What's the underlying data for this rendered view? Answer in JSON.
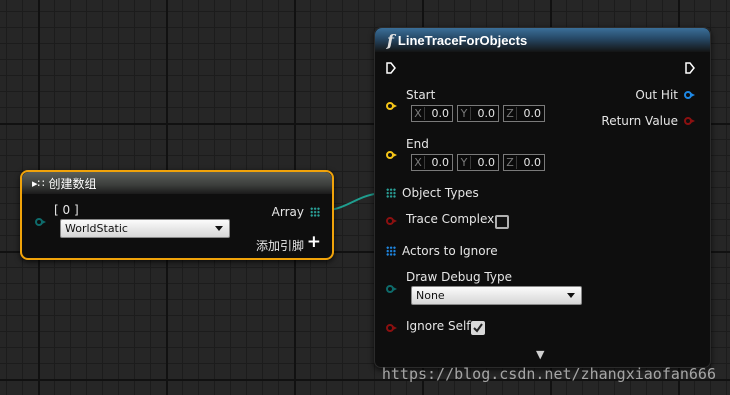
{
  "line_trace_node": {
    "title": "LineTraceForObjects",
    "function_glyph": "f",
    "inputs": {
      "start": {
        "label": "Start",
        "x": "0.0",
        "y": "0.0",
        "z": "0.0"
      },
      "end": {
        "label": "End",
        "x": "0.0",
        "y": "0.0",
        "z": "0.0"
      },
      "object_types": "Object Types",
      "trace_complex": {
        "label": "Trace Complex",
        "checked": false
      },
      "actors_to_ignore": "Actors to Ignore",
      "draw_debug_type": {
        "label": "Draw Debug Type",
        "value": "None"
      },
      "ignore_self": {
        "label": "Ignore Self",
        "checked": true
      }
    },
    "outputs": {
      "out_hit": "Out Hit",
      "return_value": "Return Value"
    },
    "axis_labels": {
      "x": "X",
      "y": "Y",
      "z": "Z"
    },
    "expand_glyph": "▼"
  },
  "make_array_node": {
    "title": "创建数组",
    "element_label": "[ 0 ]",
    "element_value": "WorldStatic",
    "output_label": "Array",
    "add_pin_label": "添加引脚",
    "add_glyph": "+"
  },
  "colors": {
    "exec": "#ffffff",
    "vector_pin": "#f5c518",
    "struct_pin": "#1e88e5",
    "bool_pin": "#8b1010",
    "enum_pin": "#0e6b6b",
    "array_pin": "#2aa198",
    "node_selected": "#f0a30a"
  },
  "watermark": "https://blog.csdn.net/zhangxiaofan666"
}
